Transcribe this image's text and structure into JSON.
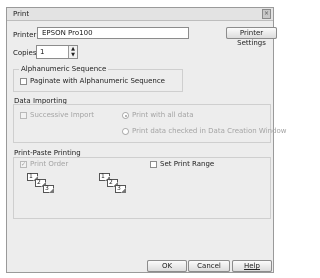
{
  "window": {
    "title": "Print",
    "close_glyph": "×"
  },
  "printer": {
    "label": "Printer",
    "value": "EPSON Pro100",
    "settings_button": "Printer Settings"
  },
  "copies": {
    "label": "Copies",
    "value": "1"
  },
  "alphanumeric": {
    "group_title": "Alphanumeric Sequence",
    "checkbox_label": "Paginate with Alphanumeric Sequence",
    "checked": false
  },
  "data_importing": {
    "group_title": "Data Importing",
    "successive_label": "Successive Import",
    "print_all_label": "Print with all data",
    "print_checked_label": "Print data checked in Data Creation Window",
    "selected": "print_all"
  },
  "print_paste": {
    "group_title": "Print-Paste Printing",
    "print_order_label": "Print Order",
    "print_order_checked": true,
    "set_range_label": "Set Print Range",
    "set_range_checked": false,
    "left_stack": [
      "1",
      "2",
      "3"
    ],
    "right_stack": [
      "1",
      "2",
      "3"
    ]
  },
  "buttons": {
    "ok": "OK",
    "cancel": "Cancel",
    "help": "Help"
  },
  "icons": {
    "close": "close-icon",
    "spin_up": "chevron-up-icon",
    "spin_down": "chevron-down-icon",
    "checkmark": "checkmark-icon"
  }
}
